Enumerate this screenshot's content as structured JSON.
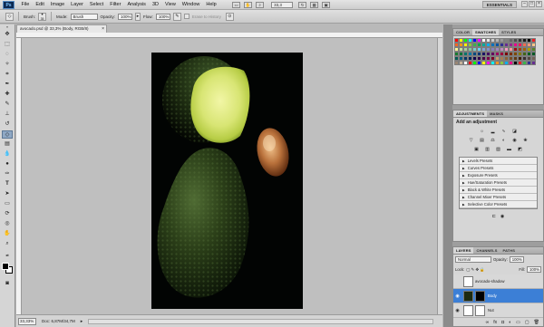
{
  "app": {
    "logo": "Ps"
  },
  "menu": [
    "File",
    "Edit",
    "Image",
    "Layer",
    "Select",
    "Filter",
    "Analysis",
    "3D",
    "View",
    "Window",
    "Help"
  ],
  "menubar": {
    "zoom": "33,3",
    "workspace": "ESSENTIALS"
  },
  "options": {
    "brush_label": "Brush:",
    "brush_size": "35",
    "mode_label": "Mode:",
    "mode_value": "Brush",
    "opacity_label": "Opacity:",
    "opacity_value": "100%",
    "flow_label": "Flow:",
    "flow_value": "100%",
    "erase_history": "Erase to History"
  },
  "document": {
    "tab_title": "avocado.psd @ 33,3% (Body, RGB/8)",
    "zoom": "33,33%",
    "doc_size": "Doc: 6,87M/34,7M"
  },
  "panels": {
    "color_tabs": [
      "COLOR",
      "SWATCHES",
      "STYLES"
    ],
    "adjust_tabs": [
      "ADJUSTMENTS",
      "MASKS"
    ],
    "adjust_title": "Add an adjustment",
    "presets": [
      "Levels Presets",
      "Curves Presets",
      "Exposure Presets",
      "Hue/Saturation Presets",
      "Black & White Presets",
      "Channel Mixer Presets",
      "Selective Color Presets"
    ],
    "layer_tabs": [
      "LAYERS",
      "CHANNELS",
      "PATHS"
    ],
    "blend_mode": "Normal",
    "opacity_label": "Opacity:",
    "opacity_value": "100%",
    "lock_label": "Lock:",
    "fill_label": "Fill:",
    "fill_value": "100%",
    "layers": [
      {
        "name": "avocado-shadow",
        "selected": false
      },
      {
        "name": "Body",
        "selected": true
      },
      {
        "name": "Nut",
        "selected": false
      }
    ]
  },
  "swatch_colors": [
    "#ff0000",
    "#ffff00",
    "#00ff00",
    "#00ffff",
    "#0000ff",
    "#ff00ff",
    "#ffffff",
    "#e6e6e6",
    "#cccccc",
    "#b3b3b3",
    "#999999",
    "#808080",
    "#666666",
    "#4d4d4d",
    "#333333",
    "#1a1a1a",
    "#000000",
    "#ed1c24",
    "#f26522",
    "#f7941d",
    "#fff200",
    "#8dc63f",
    "#39b54a",
    "#00a651",
    "#00a99d",
    "#00aeef",
    "#0072bc",
    "#0054a6",
    "#2e3192",
    "#662d91",
    "#92278f",
    "#ec008c",
    "#ed145b",
    "#f26c4f",
    "#f69679",
    "#fdc689",
    "#fff799",
    "#c4df9b",
    "#a3d39c",
    "#82ca9c",
    "#7accc8",
    "#6dcff6",
    "#7da7d9",
    "#8393ca",
    "#8781bd",
    "#a187be",
    "#bc8cbf",
    "#f49ac1",
    "#f5989d",
    "#9e0b0f",
    "#a0410d",
    "#a3620a",
    "#aba000",
    "#598527",
    "#197b30",
    "#007236",
    "#00746b",
    "#0076a3",
    "#004a80",
    "#003471",
    "#1b1464",
    "#440e62",
    "#630460",
    "#9e005d",
    "#9e0039",
    "#790000",
    "#7b2e00",
    "#7d4900",
    "#827b00",
    "#406618",
    "#005e20",
    "#005826",
    "#005952",
    "#005b7f",
    "#003663",
    "#002157",
    "#0d004c",
    "#32004b",
    "#4b0049",
    "#7b0046",
    "#7a0026",
    "#c69c6d",
    "#a67c52",
    "#8c6239",
    "#754c24",
    "#603913",
    "#42210b",
    "#362f2d",
    "#534741",
    "#736357",
    "#998675",
    "#c7b299",
    "#ffffff",
    "#ff0000",
    "#00ff00",
    "#0000ff",
    "#ffff00",
    "#ff00ff",
    "#00ffff",
    "#f7941d",
    "#8dc63f",
    "#00aeef",
    "#ec008c",
    "#000000",
    "#ed1c24",
    "#39b54a",
    "#2e3192",
    "#662d91"
  ]
}
